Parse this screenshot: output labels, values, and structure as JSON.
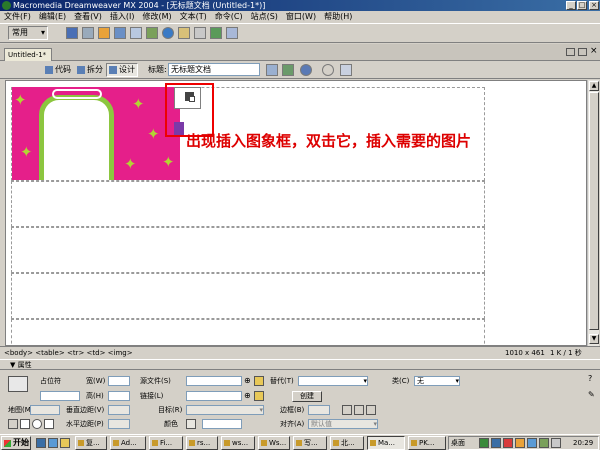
{
  "window": {
    "title": "Macromedia Dreamweaver MX 2004 - [无标题文档 (Untitled-1*)]",
    "buttons": [
      "_",
      "□",
      "×"
    ]
  },
  "menu": [
    "文件(F)",
    "编辑(E)",
    "查看(V)",
    "插入(I)",
    "修改(M)",
    "文本(T)",
    "命令(C)",
    "站点(S)",
    "窗口(W)",
    "帮助(H)"
  ],
  "insert_bar": {
    "category": "常用"
  },
  "document": {
    "tab": "Untitled-1*",
    "views": {
      "code": "代码",
      "split": "拆分",
      "design": "设计"
    },
    "title_label": "标题:",
    "title_value": "无标题文档"
  },
  "canvas": {
    "annotation": "出现插入图象框，双击它，插入需要的图片"
  },
  "status": {
    "tag_selector": "<body> <table> <tr> <td> <img>",
    "window_size": "1010 x 461",
    "download": "1 K / 1 秒"
  },
  "properties": {
    "header": "▼ 属性",
    "image_label": "占位符",
    "width_label": "宽(W)",
    "height_label": "高(H)",
    "src_label": "源文件(S)",
    "link_label": "链接(L)",
    "alt_label": "替代(T)",
    "create_button": "创建",
    "class_label": "类(C)",
    "class_value": "无",
    "map_label": "地图(M)",
    "vspace_label": "垂直边距(V)",
    "target_label": "目标(R)",
    "border_label": "边框(B)",
    "hspace_label": "水平边距(P)",
    "color_label": "颜色",
    "align_label": "对齐(A)",
    "align_value": "默认值"
  },
  "taskbar": {
    "start": "开始",
    "tasks": [
      "复...",
      "Ad...",
      "Fi...",
      "rs...",
      "ws...",
      "Ws...",
      "写...",
      "北...",
      "Ma...",
      "PK..."
    ],
    "desktop": "桌面",
    "clock": "20:29"
  },
  "colors": {
    "banner_pink": "#e51f8a",
    "frame_green": "#8cc63f",
    "annotation_red": "#dd0000",
    "titlebar_blue": "#0a246a"
  }
}
